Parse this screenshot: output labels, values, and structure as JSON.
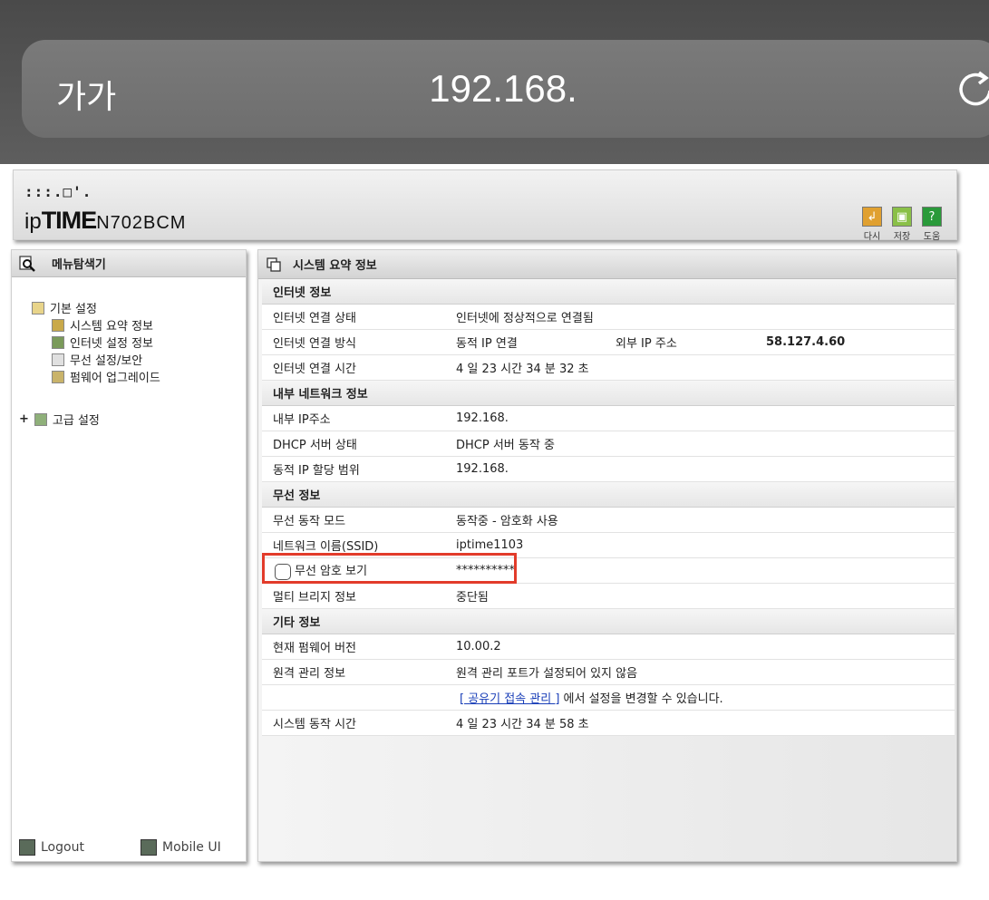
{
  "browser": {
    "text_size_button": "가가",
    "url": "192.168."
  },
  "header": {
    "logo_dots": ":::.□'.",
    "brand_ip": "ip",
    "brand_time": "TIME",
    "model": "N702BCM",
    "buttons": [
      {
        "label": "다시",
        "icon": "undo-icon",
        "color": "#e0a030"
      },
      {
        "label": "저장",
        "icon": "save-icon",
        "color": "#8ac048"
      },
      {
        "label": "도움",
        "icon": "help-icon",
        "color": "#2a9a3a"
      }
    ]
  },
  "sidebar": {
    "title": "메뉴탐색기",
    "basic_group": "기본 설정",
    "items": [
      {
        "label": "시스템 요약 정보"
      },
      {
        "label": "인터넷 설정 정보"
      },
      {
        "label": "무선 설정/보안"
      },
      {
        "label": "펌웨어 업그레이드"
      }
    ],
    "advanced_expander": "+",
    "advanced_group": "고급 설정",
    "logout": "Logout",
    "mobile": "Mobile UI"
  },
  "main": {
    "title": "시스템 요약 정보",
    "sections": {
      "internet": "인터넷 정보",
      "lan": "내부 네트워크 정보",
      "wireless": "무선 정보",
      "etc": "기타 정보"
    },
    "internet_status_label": "인터넷 연결 상태",
    "internet_status_value": "인터넷에 정상적으로 연결됨",
    "internet_method_label": "인터넷 연결 방식",
    "internet_method_value": "동적 IP 연결",
    "external_ip_label": "외부 IP 주소",
    "external_ip_value": "58.127.4.60",
    "internet_time_label": "인터넷 연결 시간",
    "internet_time_value": "4 일 23 시간 34 분 32 초",
    "lan_ip_label": "내부 IP주소",
    "lan_ip_value": "192.168.",
    "dhcp_label": "DHCP 서버 상태",
    "dhcp_value": "DHCP 서버 동작 중",
    "dhcp_range_label": "동적 IP 할당 범위",
    "dhcp_range_value": "192.168.",
    "wl_mode_label": "무선 동작 모드",
    "wl_mode_value": "동작중 - 암호화 사용",
    "ssid_label": "네트워크 이름(SSID)",
    "ssid_value": "iptime1103",
    "show_pw_label": "무선 암호 보기",
    "pw_value": "**********",
    "bridge_label": "멀티 브리지 정보",
    "bridge_value": "중단됨",
    "fw_label": "현재 펌웨어 버전",
    "fw_value": "10.00.2",
    "remote_label": "원격 관리 정보",
    "remote_value": "원격 관리 포트가 설정되어 있지 않음",
    "remote_link": "[ 공유기 접속 관리 ]",
    "remote_link_suffix": "에서 설정을 변경할 수 있습니다.",
    "uptime_label": "시스템 동작 시간",
    "uptime_value": "4 일 23 시간 34 분 58 초"
  },
  "colors": {
    "highlight_box": "#e23b2a",
    "link": "#1a3fb8"
  }
}
